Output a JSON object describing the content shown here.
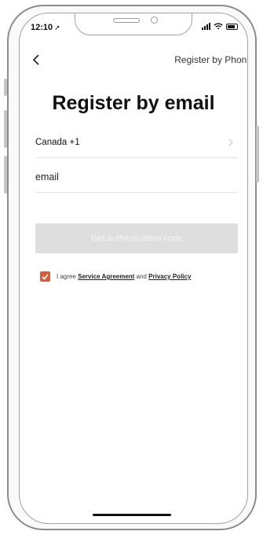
{
  "status_bar": {
    "time": "12:10",
    "location_glyph": "➚"
  },
  "nav": {
    "back_icon": "chevron-left-icon",
    "switch_link": "Register by Phone"
  },
  "title": "Register by email",
  "form": {
    "country": "Canada +1",
    "email_placeholder": "email",
    "submit_label": "Get authentication code"
  },
  "agreement": {
    "checked": true,
    "prefix": "I agree",
    "service_link": "Service Agreement",
    "conjunction": "and",
    "privacy_link": "Privacy Policy"
  },
  "colors": {
    "accent": "#d85c3c",
    "button_disabled": "#dedede",
    "text": "#111111"
  }
}
